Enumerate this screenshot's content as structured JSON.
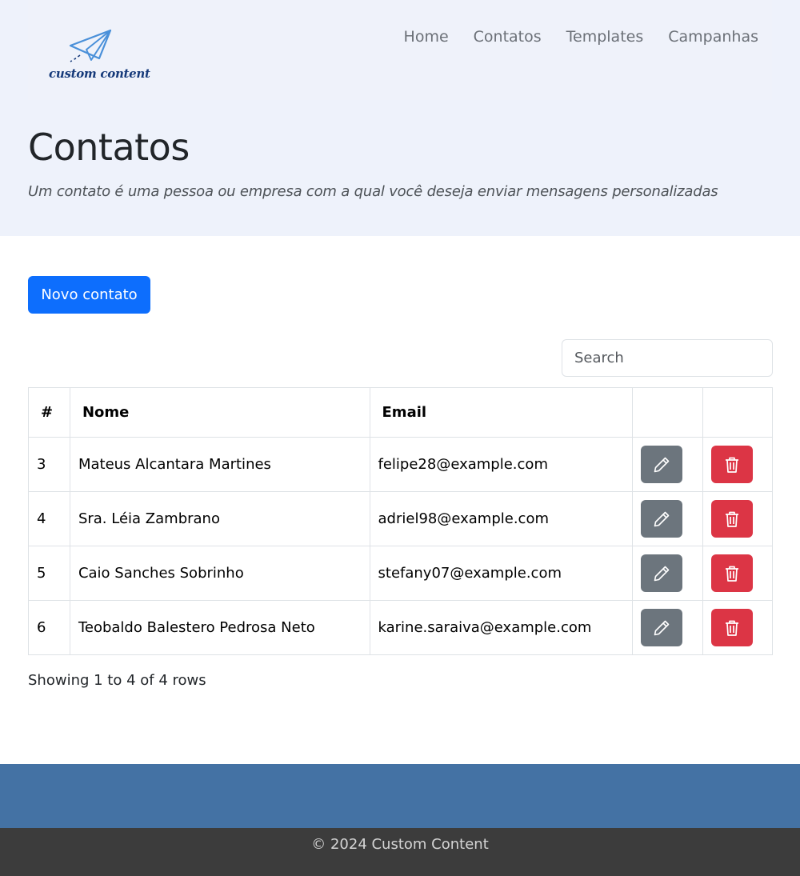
{
  "brand": {
    "logo_text": "custom content",
    "accent": "#4a90d9"
  },
  "nav": {
    "items": [
      {
        "label": "Home"
      },
      {
        "label": "Contatos"
      },
      {
        "label": "Templates"
      },
      {
        "label": "Campanhas"
      }
    ]
  },
  "header": {
    "title": "Contatos",
    "subtitle": "Um contato é uma pessoa ou empresa com a qual você deseja enviar mensagens personalizadas"
  },
  "actions": {
    "new_contact_label": "Novo contato"
  },
  "search": {
    "placeholder": "Search",
    "value": ""
  },
  "table": {
    "columns": [
      "#",
      "Nome",
      "Email",
      "",
      ""
    ],
    "rows": [
      {
        "id": "3",
        "name": "Mateus Alcantara Martines",
        "email": "felipe28@example.com"
      },
      {
        "id": "4",
        "name": "Sra. Léia Zambrano",
        "email": "adriel98@example.com"
      },
      {
        "id": "5",
        "name": "Caio Sanches Sobrinho",
        "email": "stefany07@example.com"
      },
      {
        "id": "6",
        "name": "Teobaldo Balestero Pedrosa Neto",
        "email": "karine.saraiva@example.com"
      }
    ],
    "row_actions": {
      "edit_icon": "pencil-icon",
      "delete_icon": "trash-icon"
    },
    "pagination_info": "Showing 1 to 4 of 4 rows"
  },
  "footer": {
    "copyright": "© 2024 Custom Content"
  },
  "colors": {
    "primary": "#0d6efd",
    "secondary": "#6c757d",
    "danger": "#dc3545",
    "footer_band": "#4472a4",
    "footer": "#3c3c3c",
    "hero_bg": "#eef2fb"
  }
}
